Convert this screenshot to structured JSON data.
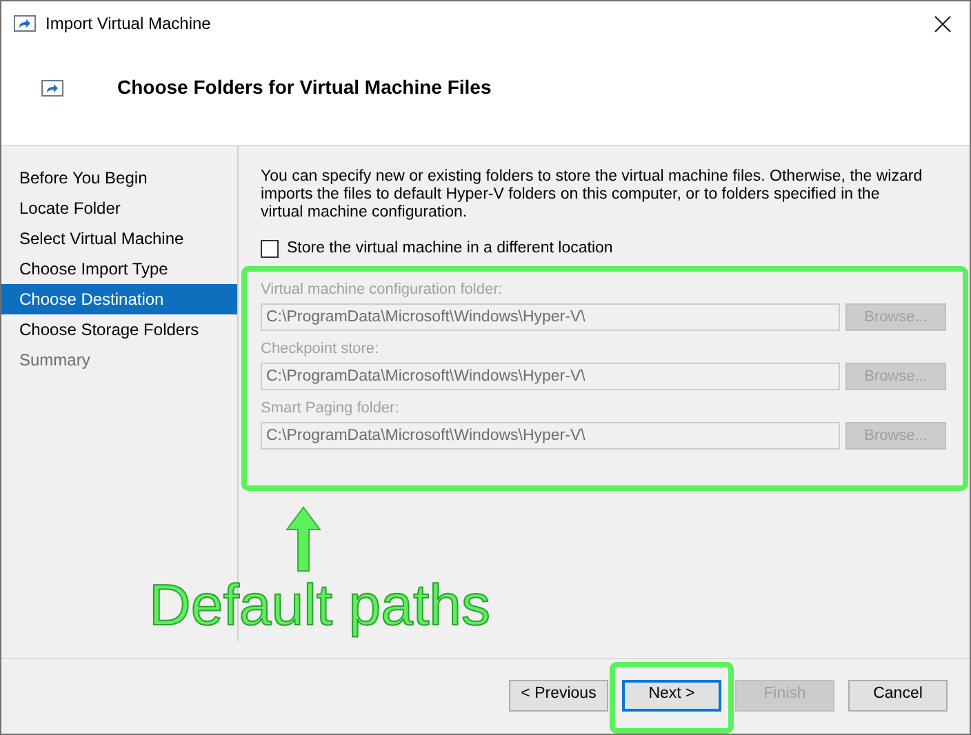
{
  "window": {
    "title": "Import Virtual Machine"
  },
  "header": {
    "title": "Choose Folders for Virtual Machine Files"
  },
  "steps": [
    {
      "label": "Before You Begin",
      "selected": false,
      "disabled": false
    },
    {
      "label": "Locate Folder",
      "selected": false,
      "disabled": false
    },
    {
      "label": "Select Virtual Machine",
      "selected": false,
      "disabled": false
    },
    {
      "label": "Choose Import Type",
      "selected": false,
      "disabled": false
    },
    {
      "label": "Choose Destination",
      "selected": true,
      "disabled": false
    },
    {
      "label": "Choose Storage Folders",
      "selected": false,
      "disabled": false
    },
    {
      "label": "Summary",
      "selected": false,
      "disabled": true
    }
  ],
  "description": "You can specify new or existing folders to store the virtual machine files. Otherwise, the wizard imports the files to default Hyper-V folders on this computer, or to folders specified in the virtual machine configuration.",
  "different_location": {
    "label": "Store the virtual machine in a different location",
    "checked": false
  },
  "folders": [
    {
      "label": "Virtual machine configuration folder:",
      "value": "C:\\ProgramData\\Microsoft\\Windows\\Hyper-V\\",
      "button": "Browse...",
      "disabled": true
    },
    {
      "label": "Checkpoint store:",
      "value": "C:\\ProgramData\\Microsoft\\Windows\\Hyper-V\\",
      "button": "Browse...",
      "disabled": true
    },
    {
      "label": "Smart Paging folder:",
      "value": "C:\\ProgramData\\Microsoft\\Windows\\Hyper-V\\",
      "button": "Browse...",
      "disabled": true
    }
  ],
  "annotation": {
    "text": "Default paths"
  },
  "buttons": [
    {
      "label": "< Previous",
      "disabled": false,
      "focused": false
    },
    {
      "label": "Next >",
      "disabled": false,
      "focused": true
    },
    {
      "label": "Finish",
      "disabled": true,
      "focused": false
    },
    {
      "label": "Cancel",
      "disabled": false,
      "focused": false
    }
  ]
}
